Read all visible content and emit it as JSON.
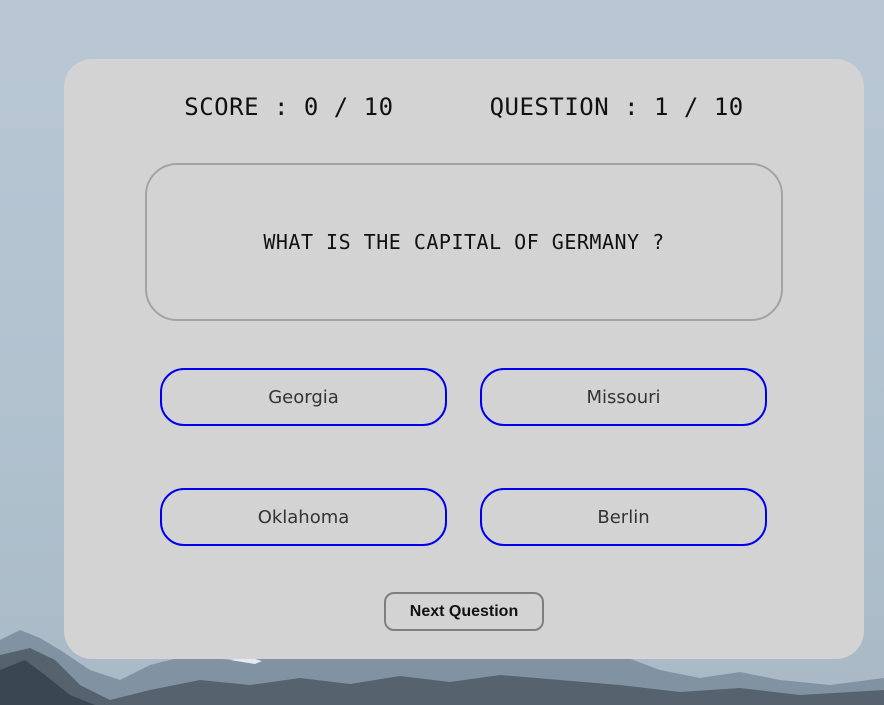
{
  "scorebar": {
    "score_text": "SCORE : 0 / 10",
    "question_text": "QUESTION : 1 / 10"
  },
  "question": {
    "text": "WHAT IS THE CAPITAL OF GERMANY ?"
  },
  "answers": [
    {
      "label": "Georgia"
    },
    {
      "label": "Missouri"
    },
    {
      "label": "Oklahoma"
    },
    {
      "label": "Berlin"
    }
  ],
  "next_button": {
    "label": "Next Question"
  },
  "colors": {
    "card_bg": "#d3d3d3",
    "answer_border": "#0000ee",
    "question_border": "#a3a3a3"
  }
}
